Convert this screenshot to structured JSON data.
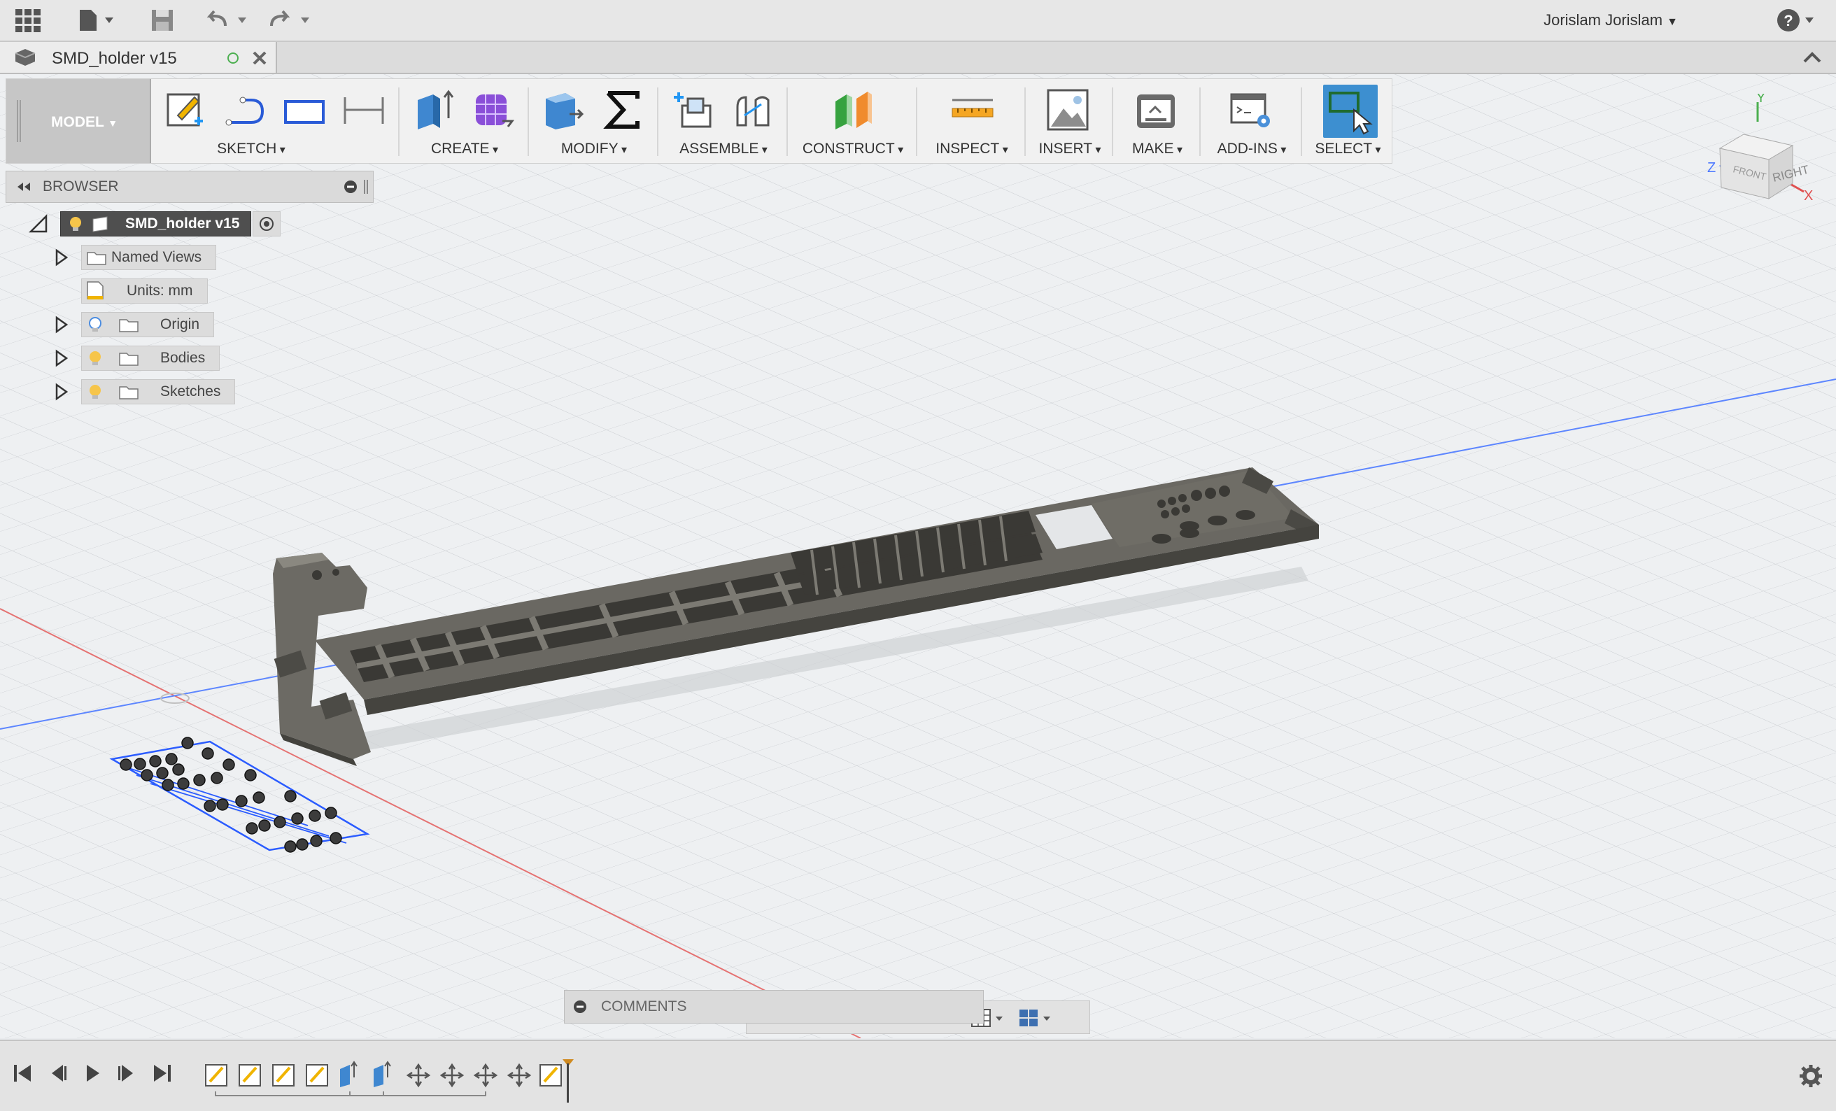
{
  "app": {
    "user_name": "Jorislam Jorislam",
    "help_label": "?"
  },
  "document": {
    "tab_title": "SMD_holder v15"
  },
  "toolbar": {
    "workspace_label": "MODEL",
    "groups": [
      {
        "label": "SKETCH"
      },
      {
        "label": "CREATE"
      },
      {
        "label": "MODIFY"
      },
      {
        "label": "ASSEMBLE"
      },
      {
        "label": "CONSTRUCT"
      },
      {
        "label": "INSPECT"
      },
      {
        "label": "INSERT"
      },
      {
        "label": "MAKE"
      },
      {
        "label": "ADD-INS"
      },
      {
        "label": "SELECT"
      }
    ]
  },
  "browser": {
    "title": "BROWSER",
    "root": "SMD_holder v15",
    "items": [
      {
        "label": "Named Views"
      },
      {
        "label": "Units: mm"
      },
      {
        "label": "Origin"
      },
      {
        "label": "Bodies"
      },
      {
        "label": "Sketches"
      }
    ]
  },
  "viewcube": {
    "face_right": "RIGHT",
    "face_front": "FRONT",
    "axis_x": "X",
    "axis_y": "Y",
    "axis_z": "Z"
  },
  "comments": {
    "title": "COMMENTS"
  },
  "colors": {
    "accent_select": "#3d8fd0",
    "model_body": "#5c5a55",
    "sketch_lines": "#2b5cff",
    "axis_red": "#e05050",
    "axis_blue": "#4c78ff"
  }
}
